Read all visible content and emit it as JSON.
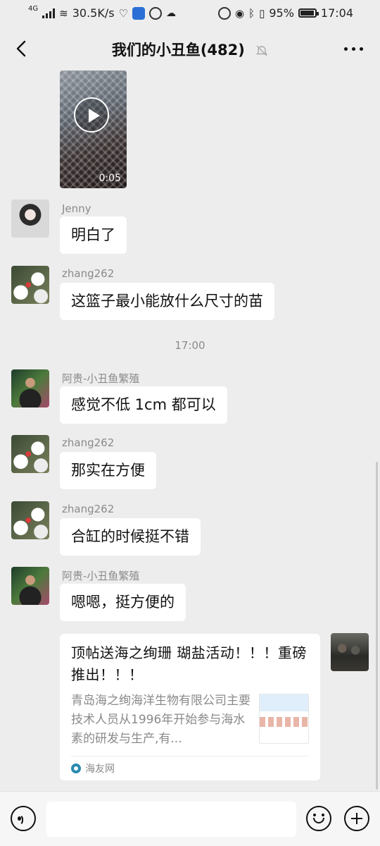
{
  "status_bar": {
    "network": "4G",
    "speed": "30.5K/s",
    "battery": "95%",
    "battery_level": 0.95,
    "time": "17:04"
  },
  "header": {
    "title": "我们的小丑鱼(482)",
    "back_icon": "chevron-left-icon",
    "mute_icon": "bell-off-icon",
    "more_icon": "more-dots-icon"
  },
  "messages": [
    {
      "type": "video",
      "duration": "0:05"
    },
    {
      "sender": "Jenny",
      "text": "明白了"
    },
    {
      "sender": "zhang262",
      "text": "这篮子最小能放什么尺寸的苗"
    },
    {
      "type": "time",
      "text": "17:00"
    },
    {
      "sender": "阿贵-小丑鱼繁殖",
      "text": "感觉不低 1cm 都可以"
    },
    {
      "sender": "zhang262",
      "text": "那实在方便"
    },
    {
      "sender": "zhang262",
      "text": "合缸的时候挺不错"
    },
    {
      "sender": "阿贵-小丑鱼繁殖",
      "text": "嗯嗯，挺方便的"
    }
  ],
  "link_card": {
    "title": "顶帖送海之绚珊 瑚盐活动！！！重磅推出！！！",
    "description": "青岛海之绚海洋生物有限公司主要技术人员从1996年开始参与海水素的研发与生产,有...",
    "source": "海友网"
  },
  "input_bar": {
    "voice_icon": "voice-icon",
    "emoji_icon": "emoji-icon",
    "plus_icon": "plus-icon",
    "placeholder": ""
  }
}
